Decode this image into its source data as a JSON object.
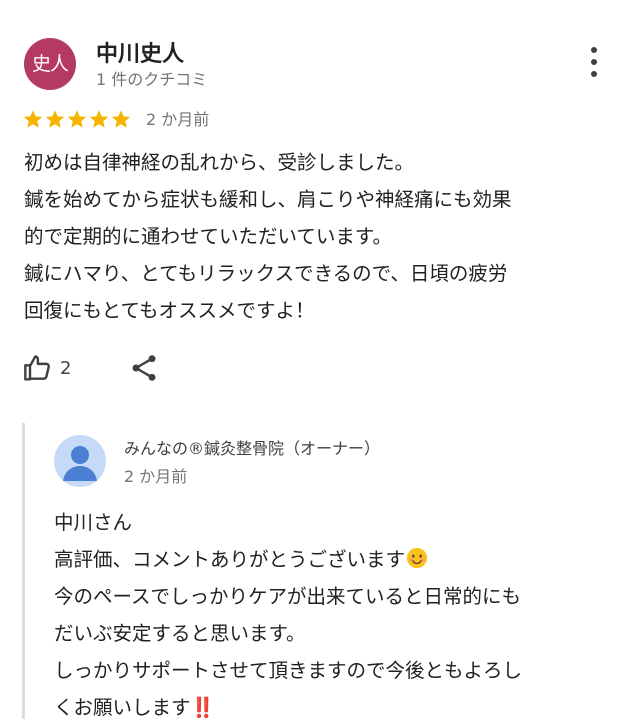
{
  "reviewer": {
    "avatar_initials": "史人",
    "name": "中川史人",
    "meta": "1 件のクチコミ"
  },
  "rating": {
    "stars": 5,
    "max": 5,
    "date": "2 か月前"
  },
  "review_text_lines": [
    "初めは自律神経の乱れから、受診しました。",
    "鍼を始めてから症状も緩和し、肩こりや神経痛にも効果",
    "的で定期的に通わせていただいています。",
    "鍼にハマり、とてもリラックスできるので、日頃の疲労",
    "回復にもとてもオススメですよ！"
  ],
  "actions": {
    "like_count": "2",
    "icons": [
      "thumb-up-icon",
      "share-icon",
      "more-vert-icon"
    ]
  },
  "owner_reply": {
    "name": "みんなの®鍼灸整骨院（オーナー）",
    "date": "2 か月前",
    "lines": [
      "中川さん",
      "高評価、コメントありがとうございます",
      "今のペースでしっかりケアが出来ていると日常的にも",
      "だいぶ安定すると思います。",
      "しっかりサポートさせて頂きますので今後ともよろし",
      "くお願いします"
    ],
    "bang_emoji": "‼️"
  },
  "colors": {
    "avatar_bg": "#b43a63",
    "star": "#f6b400",
    "secondary_text": "#70757a",
    "reply_bar": "#dadce0",
    "owner_avatar_bg": "#c6d9f7",
    "owner_avatar_fg": "#4a7fd4"
  }
}
